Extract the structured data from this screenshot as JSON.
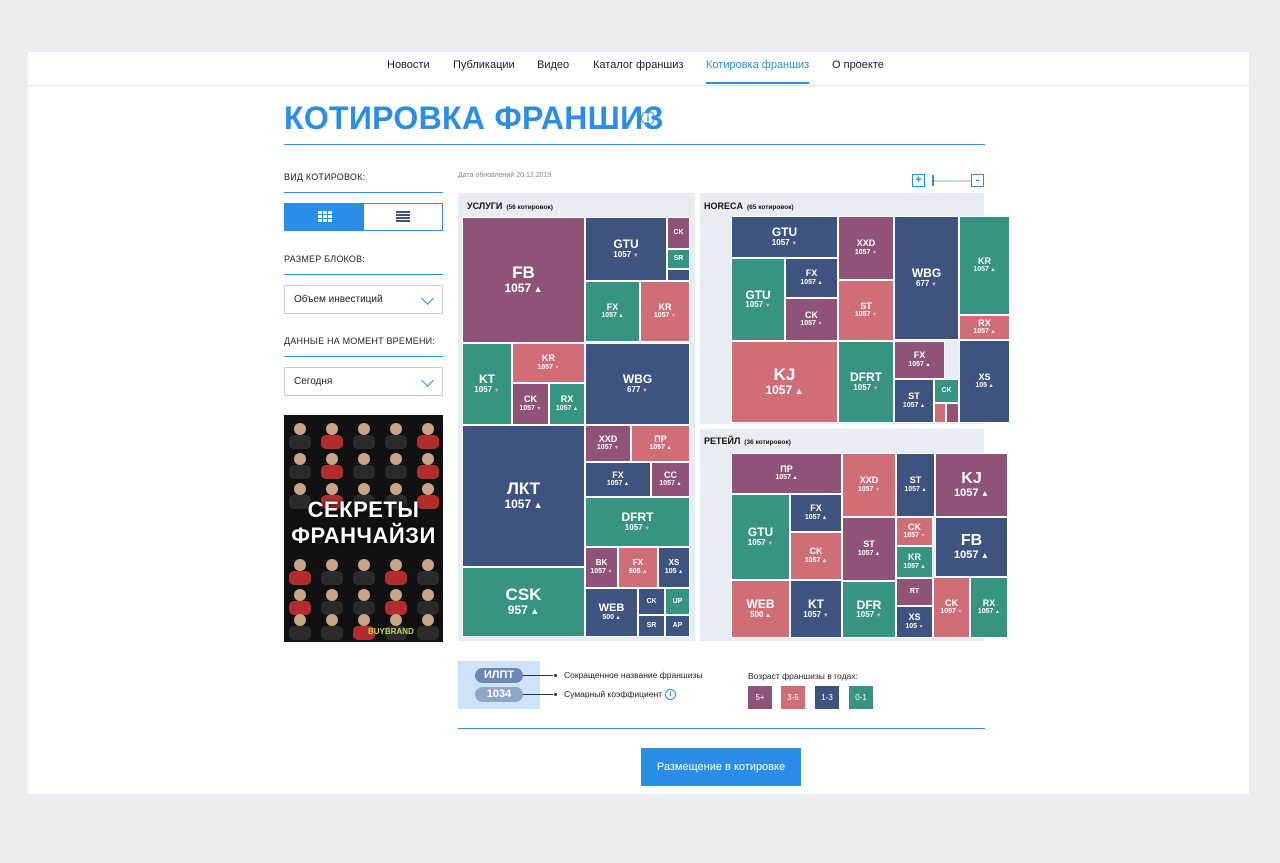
{
  "nav": [
    "Новости",
    "Публикации",
    "Видео",
    "Каталог франшиз",
    "Котировка франшиз",
    "О проекте"
  ],
  "title": "КОТИРОВКА ФРАНШИЗ",
  "sidebar": {
    "view_label": "ВИД КОТИРОВОК:",
    "size_label": "РАЗМЕР БЛОКОВ:",
    "size_value": "Объем инвестиций",
    "time_label": "ДАННЫЕ НА МОМЕНТ ВРЕМЕНИ:",
    "time_value": "Сегодня"
  },
  "ad": {
    "line1": "СЕКРЕТЫ",
    "line2": "ФРАНЧАЙЗИ",
    "logo": "BUYBRAND"
  },
  "date": "Дата обновлений 20.12.2019",
  "zoom": {
    "plus": "+",
    "minus": "-"
  },
  "colors": {
    "5+": "#8e5376",
    "3-5": "#d06e78",
    "1-3": "#3e547f",
    "0-1": "#379483",
    "accent": "#2a8ee8"
  },
  "panels": [
    {
      "title": "УСЛУГИ",
      "count": "(56 котировок)",
      "tiles": [
        {
          "n": "FB",
          "v": "1057",
          "d": "up",
          "c": "t5"
        },
        {
          "n": "GTU",
          "v": "1057",
          "d": "dn",
          "c": "t13"
        },
        {
          "n": "CK",
          "v": "",
          "d": "",
          "c": "t5"
        },
        {
          "n": "SR",
          "v": "",
          "d": "",
          "c": "t01"
        },
        {
          "n": "",
          "v": "",
          "d": "",
          "c": "t13"
        },
        {
          "n": "FX",
          "v": "1057",
          "d": "up",
          "c": "t01"
        },
        {
          "n": "KR",
          "v": "1057",
          "d": "dn",
          "c": "t35"
        },
        {
          "n": "KT",
          "v": "1057",
          "d": "dn",
          "c": "t01"
        },
        {
          "n": "KR",
          "v": "1057",
          "d": "dn",
          "c": "t35"
        },
        {
          "n": "CK",
          "v": "1057",
          "d": "dn",
          "c": "t5"
        },
        {
          "n": "RX",
          "v": "1057",
          "d": "up",
          "c": "t01"
        },
        {
          "n": "WBG",
          "v": "677",
          "d": "dn",
          "c": "t13"
        },
        {
          "n": "ЛКТ",
          "v": "1057",
          "d": "up",
          "c": "t13"
        },
        {
          "n": "XXD",
          "v": "1057",
          "d": "dn",
          "c": "t5"
        },
        {
          "n": "ПР",
          "v": "1057",
          "d": "up",
          "c": "t35"
        },
        {
          "n": "FX",
          "v": "1057",
          "d": "up",
          "c": "t13"
        },
        {
          "n": "CC",
          "v": "1057",
          "d": "up",
          "c": "t5"
        },
        {
          "n": "DFRT",
          "v": "1057",
          "d": "dn",
          "c": "t01"
        },
        {
          "n": "CSK",
          "v": "957",
          "d": "up",
          "c": "t01"
        },
        {
          "n": "BK",
          "v": "1057",
          "d": "dn",
          "c": "t5"
        },
        {
          "n": "FX",
          "v": "605",
          "d": "up",
          "c": "t35"
        },
        {
          "n": "XS",
          "v": "105",
          "d": "up",
          "c": "t13"
        },
        {
          "n": "WEB",
          "v": "500",
          "d": "up",
          "c": "t13"
        },
        {
          "n": "CK",
          "v": "",
          "d": "",
          "c": "t13"
        },
        {
          "n": "UP",
          "v": "",
          "d": "",
          "c": "t01"
        },
        {
          "n": "SR",
          "v": "",
          "d": "",
          "c": "t13"
        },
        {
          "n": "AP",
          "v": "",
          "d": "",
          "c": "t13"
        }
      ]
    },
    {
      "title": "HORECA",
      "count": "(65 котировок)",
      "tiles": [
        {
          "n": "GTU",
          "v": "1057",
          "d": "dn",
          "c": "t13"
        },
        {
          "n": "XXD",
          "v": "1057",
          "d": "dn",
          "c": "t5"
        },
        {
          "n": "WBG",
          "v": "677",
          "d": "dn",
          "c": "t13"
        },
        {
          "n": "KR",
          "v": "1057",
          "d": "up",
          "c": "t01"
        },
        {
          "n": "GTU",
          "v": "1057",
          "d": "dn",
          "c": "t01"
        },
        {
          "n": "FX",
          "v": "1057",
          "d": "up",
          "c": "t13"
        },
        {
          "n": "ST",
          "v": "1057",
          "d": "dn",
          "c": "t35"
        },
        {
          "n": "CK",
          "v": "1057",
          "d": "dn",
          "c": "t5"
        },
        {
          "n": "RX",
          "v": "1057",
          "d": "up",
          "c": "t35"
        },
        {
          "n": "KJ",
          "v": "1057",
          "d": "up",
          "c": "t35"
        },
        {
          "n": "DFRT",
          "v": "1057",
          "d": "dn",
          "c": "t01"
        },
        {
          "n": "FX",
          "v": "1057",
          "d": "up",
          "c": "t5"
        },
        {
          "n": "XS",
          "v": "105",
          "d": "up",
          "c": "t13"
        },
        {
          "n": "ST",
          "v": "1057",
          "d": "up",
          "c": "t13"
        },
        {
          "n": "CK",
          "v": "",
          "d": "",
          "c": "t01"
        },
        {
          "n": "",
          "v": "",
          "d": "",
          "c": "t35"
        },
        {
          "n": "",
          "v": "",
          "d": "",
          "c": "t5"
        }
      ]
    },
    {
      "title": "РЕТЕЙЛ",
      "count": "(36 котировок)",
      "tiles": [
        {
          "n": "ПР",
          "v": "1057",
          "d": "up",
          "c": "t5"
        },
        {
          "n": "XXD",
          "v": "1057",
          "d": "dn",
          "c": "t35"
        },
        {
          "n": "ST",
          "v": "1057",
          "d": "up",
          "c": "t13"
        },
        {
          "n": "KJ",
          "v": "1057",
          "d": "up",
          "c": "t5"
        },
        {
          "n": "GTU",
          "v": "1057",
          "d": "dn",
          "c": "t01"
        },
        {
          "n": "FX",
          "v": "1057",
          "d": "up",
          "c": "t13"
        },
        {
          "n": "CK",
          "v": "1057",
          "d": "up",
          "c": "t35"
        },
        {
          "n": "ST",
          "v": "1057",
          "d": "up",
          "c": "t5"
        },
        {
          "n": "CK",
          "v": "1057",
          "d": "dn",
          "c": "t35"
        },
        {
          "n": "KR",
          "v": "1057",
          "d": "up",
          "c": "t01"
        },
        {
          "n": "FB",
          "v": "1057",
          "d": "up",
          "c": "t13"
        },
        {
          "n": "WEB",
          "v": "500",
          "d": "up",
          "c": "t35"
        },
        {
          "n": "KT",
          "v": "1057",
          "d": "dn",
          "c": "t13"
        },
        {
          "n": "DFR",
          "v": "1057",
          "d": "dn",
          "c": "t01"
        },
        {
          "n": "RT",
          "v": "",
          "d": "",
          "c": "t5"
        },
        {
          "n": "XS",
          "v": "105",
          "d": "dn",
          "c": "t13"
        },
        {
          "n": "CK",
          "v": "1057",
          "d": "dn",
          "c": "t35"
        },
        {
          "n": "RX",
          "v": "1057",
          "d": "up",
          "c": "t01"
        }
      ]
    }
  ],
  "legend": {
    "sample_name": "ИЛПТ",
    "sample_value": "1034",
    "name_desc": "Сокращенное название франшизы",
    "value_desc": "Сумарный коэффициент",
    "age_title": "Возраст франшизы в годах:",
    "ages": [
      "5+",
      "3-5",
      "1-3",
      "0-1"
    ]
  },
  "cta": "Размещение в котировке"
}
